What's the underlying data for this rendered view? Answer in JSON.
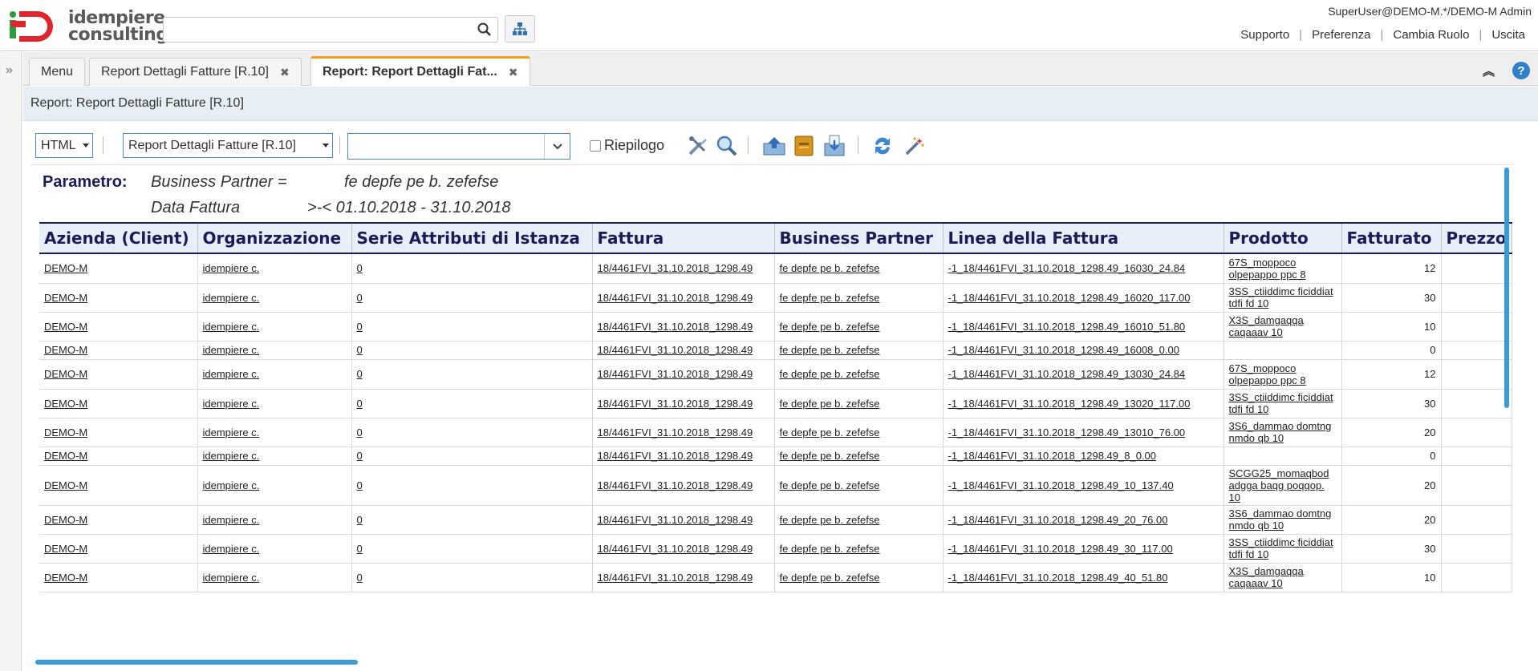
{
  "brand": {
    "line1": "idempiere",
    "line2": "consulting"
  },
  "header": {
    "user": "SuperUser@DEMO-M.*/DEMO-M Admin",
    "links": [
      "Supporto",
      "Preferenza",
      "Cambia Ruolo",
      "Uscita"
    ]
  },
  "tabs": [
    {
      "label": "Menu"
    },
    {
      "label": "Report Dettagli Fatture [R.10]"
    },
    {
      "label": "Report: Report Dettagli Fat..."
    }
  ],
  "title": "Report: Report Dettagli Fatture [R.10]",
  "toolbar": {
    "format": "HTML",
    "print_format": "Report Dettagli Fatture [R.10]",
    "combo_value": "",
    "summary_label": "Riepilogo"
  },
  "params": {
    "label": "Parametro:",
    "rows": [
      {
        "name": "Business Partner =",
        "value": "fe depfe pe b. zefefse"
      },
      {
        "name": "Data Fattura",
        "value": ">-< 01.10.2018 - 31.10.2018"
      }
    ]
  },
  "table": {
    "columns": [
      "Azienda (Client)",
      "Organizzazione",
      "Serie Attributi di Istanza",
      "Fattura",
      "Business Partner",
      "Linea della Fattura",
      "Prodotto",
      "Fatturato",
      "Prezzo"
    ],
    "rows": [
      [
        "DEMO-M",
        "idempiere c.",
        "0",
        "18/4461FVI_31.10.2018_1298.49",
        "fe depfe pe b. zefefse",
        "-1_18/4461FVI_31.10.2018_1298.49_16030_24.84",
        "67S_moppoco olpepappo ppc 8",
        "12",
        ""
      ],
      [
        "DEMO-M",
        "idempiere c.",
        "0",
        "18/4461FVI_31.10.2018_1298.49",
        "fe depfe pe b. zefefse",
        "-1_18/4461FVI_31.10.2018_1298.49_16020_117.00",
        "3SS_ctiiddimc ficiddiat tdfi fd 10",
        "30",
        ""
      ],
      [
        "DEMO-M",
        "idempiere c.",
        "0",
        "18/4461FVI_31.10.2018_1298.49",
        "fe depfe pe b. zefefse",
        "-1_18/4461FVI_31.10.2018_1298.49_16010_51.80",
        "X3S_damgaqqa caqaaav 10",
        "10",
        ""
      ],
      [
        "DEMO-M",
        "idempiere c.",
        "0",
        "18/4461FVI_31.10.2018_1298.49",
        "fe depfe pe b. zefefse",
        "-1_18/4461FVI_31.10.2018_1298.49_16008_0.00",
        "",
        "0",
        ""
      ],
      [
        "DEMO-M",
        "idempiere c.",
        "0",
        "18/4461FVI_31.10.2018_1298.49",
        "fe depfe pe b. zefefse",
        "-1_18/4461FVI_31.10.2018_1298.49_13030_24.84",
        "67S_moppoco olpepappo ppc 8",
        "12",
        ""
      ],
      [
        "DEMO-M",
        "idempiere c.",
        "0",
        "18/4461FVI_31.10.2018_1298.49",
        "fe depfe pe b. zefefse",
        "-1_18/4461FVI_31.10.2018_1298.49_13020_117.00",
        "3SS_ctiiddimc ficiddiat tdfi fd 10",
        "30",
        ""
      ],
      [
        "DEMO-M",
        "idempiere c.",
        "0",
        "18/4461FVI_31.10.2018_1298.49",
        "fe depfe pe b. zefefse",
        "-1_18/4461FVI_31.10.2018_1298.49_13010_76.00",
        "3S6_dammao domtng nmdo qb 10",
        "20",
        ""
      ],
      [
        "DEMO-M",
        "idempiere c.",
        "0",
        "18/4461FVI_31.10.2018_1298.49",
        "fe depfe pe b. zefefse",
        "-1_18/4461FVI_31.10.2018_1298.49_8_0.00",
        "",
        "0",
        ""
      ],
      [
        "DEMO-M",
        "idempiere c.",
        "0",
        "18/4461FVI_31.10.2018_1298.49",
        "fe depfe pe b. zefefse",
        "-1_18/4461FVI_31.10.2018_1298.49_10_137.40",
        "SCGG25_momaqbod adgga baqg poqqop. 10",
        "20",
        ""
      ],
      [
        "DEMO-M",
        "idempiere c.",
        "0",
        "18/4461FVI_31.10.2018_1298.49",
        "fe depfe pe b. zefefse",
        "-1_18/4461FVI_31.10.2018_1298.49_20_76.00",
        "3S6_dammao domtng nmdo qb 10",
        "20",
        ""
      ],
      [
        "DEMO-M",
        "idempiere c.",
        "0",
        "18/4461FVI_31.10.2018_1298.49",
        "fe depfe pe b. zefefse",
        "-1_18/4461FVI_31.10.2018_1298.49_30_117.00",
        "3SS_ctiiddimc ficiddiat tdfi fd 10",
        "30",
        ""
      ],
      [
        "DEMO-M",
        "idempiere c.",
        "0",
        "18/4461FVI_31.10.2018_1298.49",
        "fe depfe pe b. zefefse",
        "-1_18/4461FVI_31.10.2018_1298.49_40_51.80",
        "X3S_damgaqqa caqaaav 10",
        "10",
        ""
      ]
    ]
  },
  "colors": {
    "accent": "#f3a019",
    "header_blue": "#1b1b5a",
    "scroll": "#3b9bd9",
    "title_strip": "#e7eef5"
  },
  "icons": [
    "search-icon",
    "sitemap-icon",
    "expand-west-icon",
    "collapse-up-icon",
    "help-icon",
    "customize-icon",
    "find-icon",
    "send-icon",
    "archive-icon",
    "export-icon",
    "refresh-icon",
    "wizard-icon"
  ]
}
